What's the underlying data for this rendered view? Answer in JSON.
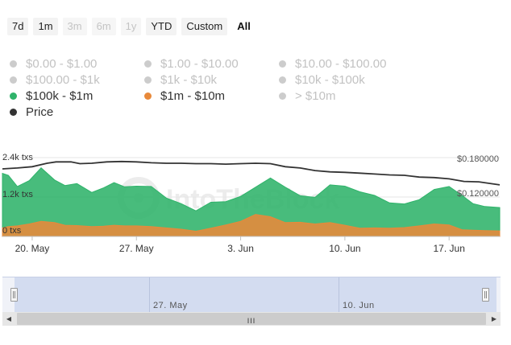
{
  "range_buttons": [
    {
      "label": "7d",
      "state": "enabled"
    },
    {
      "label": "1m",
      "state": "enabled"
    },
    {
      "label": "3m",
      "state": "disabled"
    },
    {
      "label": "6m",
      "state": "disabled"
    },
    {
      "label": "1y",
      "state": "disabled"
    },
    {
      "label": "YTD",
      "state": "enabled"
    },
    {
      "label": "Custom",
      "state": "enabled"
    },
    {
      "label": "All",
      "state": "active"
    }
  ],
  "legend": [
    {
      "label": "$0.00 - $1.00",
      "color": "#cccccc",
      "visible": false
    },
    {
      "label": "$1.00 - $10.00",
      "color": "#cccccc",
      "visible": false
    },
    {
      "label": "$10.00 - $100.00",
      "color": "#cccccc",
      "visible": false
    },
    {
      "label": "$100.00 - $1k",
      "color": "#cccccc",
      "visible": false
    },
    {
      "label": "$1k - $10k",
      "color": "#cccccc",
      "visible": false
    },
    {
      "label": "$10k - $100k",
      "color": "#cccccc",
      "visible": false
    },
    {
      "label": "$100k - $1m",
      "color": "#2fb36a",
      "visible": true
    },
    {
      "label": "$1m - $10m",
      "color": "#e8893a",
      "visible": true
    },
    {
      "label": "> $10m",
      "color": "#cccccc",
      "visible": false
    },
    {
      "label": "Price",
      "color": "#333333",
      "visible": true
    }
  ],
  "chart_data": {
    "type": "area",
    "y_left_ticks": [
      "2.4k txs",
      "1.2k txs",
      "0 txs"
    ],
    "y_right_ticks": [
      "$0.180000",
      "$0.120000"
    ],
    "x_ticks": [
      {
        "label": "20. May",
        "day": 2
      },
      {
        "label": "27. May",
        "day": 9
      },
      {
        "label": "3. Jun",
        "day": 16
      },
      {
        "label": "10. Jun",
        "day": 23
      },
      {
        "label": "17. Jun",
        "day": 30
      }
    ],
    "x_days": [
      0,
      0.4,
      1,
      1.8,
      2.6,
      3.5,
      4.2,
      5,
      6,
      6.8,
      7.5,
      8.2,
      9,
      10,
      11,
      12,
      13,
      14,
      15,
      16,
      17,
      18,
      19,
      20,
      21,
      22,
      23,
      24,
      25,
      26,
      27,
      28,
      29,
      30,
      30.9,
      31.6,
      32.4,
      33.4
    ],
    "series": [
      {
        "name": "$100k - $1m",
        "color": "#2fb36a",
        "values": [
          1920,
          1860,
          1520,
          1700,
          2090,
          1720,
          1550,
          1610,
          1340,
          1480,
          1640,
          1510,
          1530,
          1520,
          1170,
          1000,
          780,
          1040,
          1060,
          1220,
          1500,
          1780,
          1500,
          1240,
          1190,
          1570,
          1530,
          1360,
          1250,
          1020,
          990,
          1120,
          1430,
          1520,
          1240,
          1000,
          910,
          880
        ],
        "markers": []
      },
      {
        "name": "$1m - $10m",
        "color": "#e8893a",
        "values": [
          260,
          300,
          320,
          380,
          460,
          420,
          340,
          330,
          300,
          310,
          340,
          320,
          320,
          300,
          260,
          220,
          160,
          250,
          350,
          460,
          670,
          600,
          420,
          430,
          380,
          420,
          340,
          250,
          260,
          250,
          270,
          320,
          380,
          350,
          200,
          190,
          180,
          170
        ],
        "markers": []
      }
    ],
    "price": {
      "name": "Price",
      "color": "#333333",
      "unit": "USD",
      "axis_max": 0.18,
      "axis_tick": 0.12,
      "x_days": [
        0,
        1,
        2,
        3,
        3.6,
        4.6,
        5.2,
        6,
        7,
        8,
        9,
        10,
        11,
        12,
        13,
        14,
        15,
        16,
        17,
        18,
        19,
        20,
        21,
        22,
        23,
        24,
        25,
        26,
        27,
        28,
        29,
        30,
        31,
        32,
        33.4
      ],
      "values": [
        0.1543,
        0.1563,
        0.1593,
        0.1672,
        0.1702,
        0.1702,
        0.1662,
        0.1672,
        0.1702,
        0.1711,
        0.1702,
        0.1682,
        0.1672,
        0.1672,
        0.1662,
        0.1662,
        0.1652,
        0.1662,
        0.1672,
        0.1662,
        0.1593,
        0.1563,
        0.1504,
        0.1474,
        0.1464,
        0.1445,
        0.1425,
        0.1405,
        0.1395,
        0.1355,
        0.1345,
        0.1316,
        0.1257,
        0.1247,
        0.1178
      ]
    },
    "ylim": [
      0,
      2400
    ],
    "xlim": [
      0,
      33.4
    ],
    "grid": true,
    "legend_placement": "top",
    "watermark": "IntoTheBlock"
  },
  "navigator": {
    "labels": [
      "27. May",
      "10. Jun"
    ],
    "scroll_grip": "III"
  }
}
